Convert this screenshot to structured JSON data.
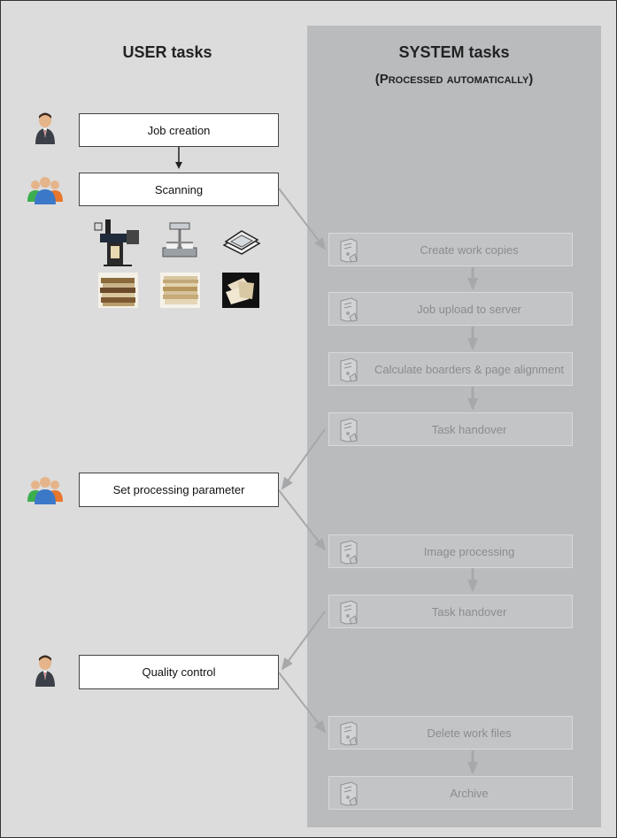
{
  "headings": {
    "user": "USER tasks",
    "system": "SYSTEM tasks",
    "system_sub": "(Processed automatically)"
  },
  "user_tasks": [
    "Job creation",
    "Scanning",
    "Set processing parameter",
    "Quality control"
  ],
  "system_tasks": [
    "Create work copies",
    "Job upload to server",
    "Calculate boarders & page alignment",
    "Task handover",
    "Image processing",
    "Task handover",
    "Delete work files",
    "Archive"
  ],
  "icons": {
    "single_user": "user-icon",
    "user_group": "user-group-icon",
    "server": "server-icon",
    "scanners": [
      "book-scanner-icon",
      "overhead-scanner-icon",
      "flatbed-scanner-icon"
    ],
    "documents": [
      "books-icon",
      "paper-stack-icon",
      "loose-documents-icon"
    ]
  },
  "colors": {
    "background": "#dcdcdc",
    "system_column": "#b9bbbd",
    "system_box": "#c2c4c6",
    "system_text": "#8a8c8e",
    "user_box": "#ffffff"
  }
}
